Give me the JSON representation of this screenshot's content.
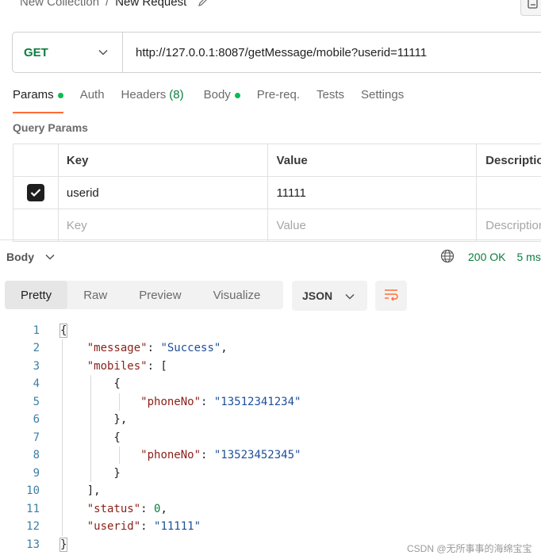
{
  "breadcrumb": {
    "collection": "New Collection",
    "separator": "/",
    "request": "New Request"
  },
  "request": {
    "method": "GET",
    "url": "http://127.0.0.1:8087/getMessage/mobile?userid=11111"
  },
  "request_tabs": {
    "params": "Params",
    "auth": "Auth",
    "headers": "Headers",
    "headers_count": "(8)",
    "body": "Body",
    "prereq": "Pre-req.",
    "tests": "Tests",
    "settings": "Settings"
  },
  "query_params": {
    "title": "Query Params",
    "headers": {
      "key": "Key",
      "value": "Value",
      "description": "Description"
    },
    "rows": [
      {
        "checked": true,
        "key": "userid",
        "value": "11111",
        "description": ""
      }
    ],
    "placeholders": {
      "key": "Key",
      "value": "Value",
      "description": "Description"
    }
  },
  "response": {
    "section_label": "Body",
    "status": "200 OK",
    "time": "5 ms",
    "view_tabs": {
      "pretty": "Pretty",
      "raw": "Raw",
      "preview": "Preview",
      "visualize": "Visualize"
    },
    "format": "JSON",
    "line_numbers": [
      "1",
      "2",
      "3",
      "4",
      "5",
      "6",
      "7",
      "8",
      "9",
      "10",
      "11",
      "12",
      "13"
    ],
    "json": {
      "message_key": "\"message\"",
      "message_value": "\"Success\"",
      "mobiles_key": "\"mobiles\"",
      "phone_key": "\"phoneNo\"",
      "phone_1": "\"13512341234\"",
      "phone_2": "\"13523452345\"",
      "status_key": "\"status\"",
      "status_value": "0",
      "userid_key": "\"userid\"",
      "userid_value": "\"11111\""
    }
  },
  "watermark": "CSDN @无所事事的海绵宝宝",
  "colors": {
    "accent": "#ff6c37",
    "method_green": "#0b7d3e",
    "dot_green": "#0cbb52",
    "json_key": "#8a1f17",
    "json_string": "#1d4f9a"
  },
  "icons": [
    "pencil-icon",
    "docs-icon",
    "chevron-down-icon",
    "check-icon",
    "globe-icon",
    "wrap-lines-icon"
  ]
}
